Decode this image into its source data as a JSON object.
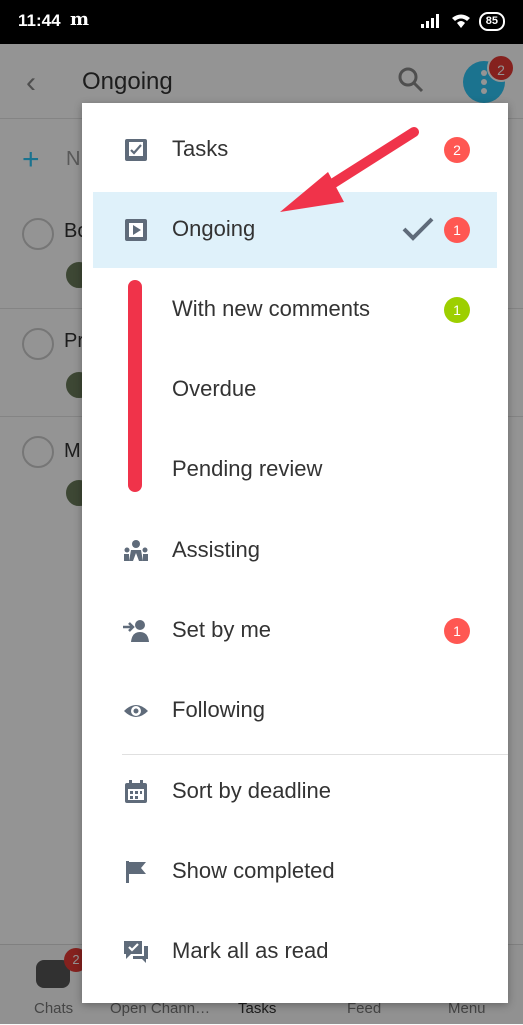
{
  "status_bar": {
    "time": "11:44",
    "carrier_glyph": "m",
    "battery": "85"
  },
  "header": {
    "title": "Ongoing",
    "menu_badge": "2"
  },
  "new_task": {
    "label": "N"
  },
  "task_rows": [
    {
      "title_fragment": "Bo"
    },
    {
      "title_fragment": "Pr"
    },
    {
      "title_fragment": "M"
    }
  ],
  "bottom_nav": {
    "items": [
      "Chats",
      "Open Chann…",
      "Tasks",
      "Feed",
      "Menu"
    ],
    "chats_badge": "2"
  },
  "menu": {
    "items": [
      {
        "label": "Tasks",
        "icon": "tasks-icon",
        "badge": "2",
        "badge_color": "#ff5752"
      },
      {
        "label": "Ongoing",
        "icon": "play-square-icon",
        "badge": "1",
        "badge_color": "#ff5752",
        "selected": true
      },
      {
        "label": "With new comments",
        "icon": "",
        "badge": "1",
        "badge_color": "#9dcf00"
      },
      {
        "label": "Overdue",
        "icon": ""
      },
      {
        "label": "Pending review",
        "icon": ""
      },
      {
        "label": "Assisting",
        "icon": "people-icon"
      },
      {
        "label": "Set by me",
        "icon": "user-arrow-icon",
        "badge": "1",
        "badge_color": "#ff5752"
      },
      {
        "label": "Following",
        "icon": "eye-icon"
      },
      {
        "label": "Sort by deadline",
        "icon": "calendar-icon"
      },
      {
        "label": "Show completed",
        "icon": "flag-icon"
      },
      {
        "label": "Mark all as read",
        "icon": "chat-check-icon"
      }
    ]
  },
  "colors": {
    "accent": "#2fc6f6",
    "badge_red": "#ff5752",
    "badge_green": "#9dcf00",
    "highlight": "#dff1fa",
    "annotation_red": "#f0334a"
  }
}
